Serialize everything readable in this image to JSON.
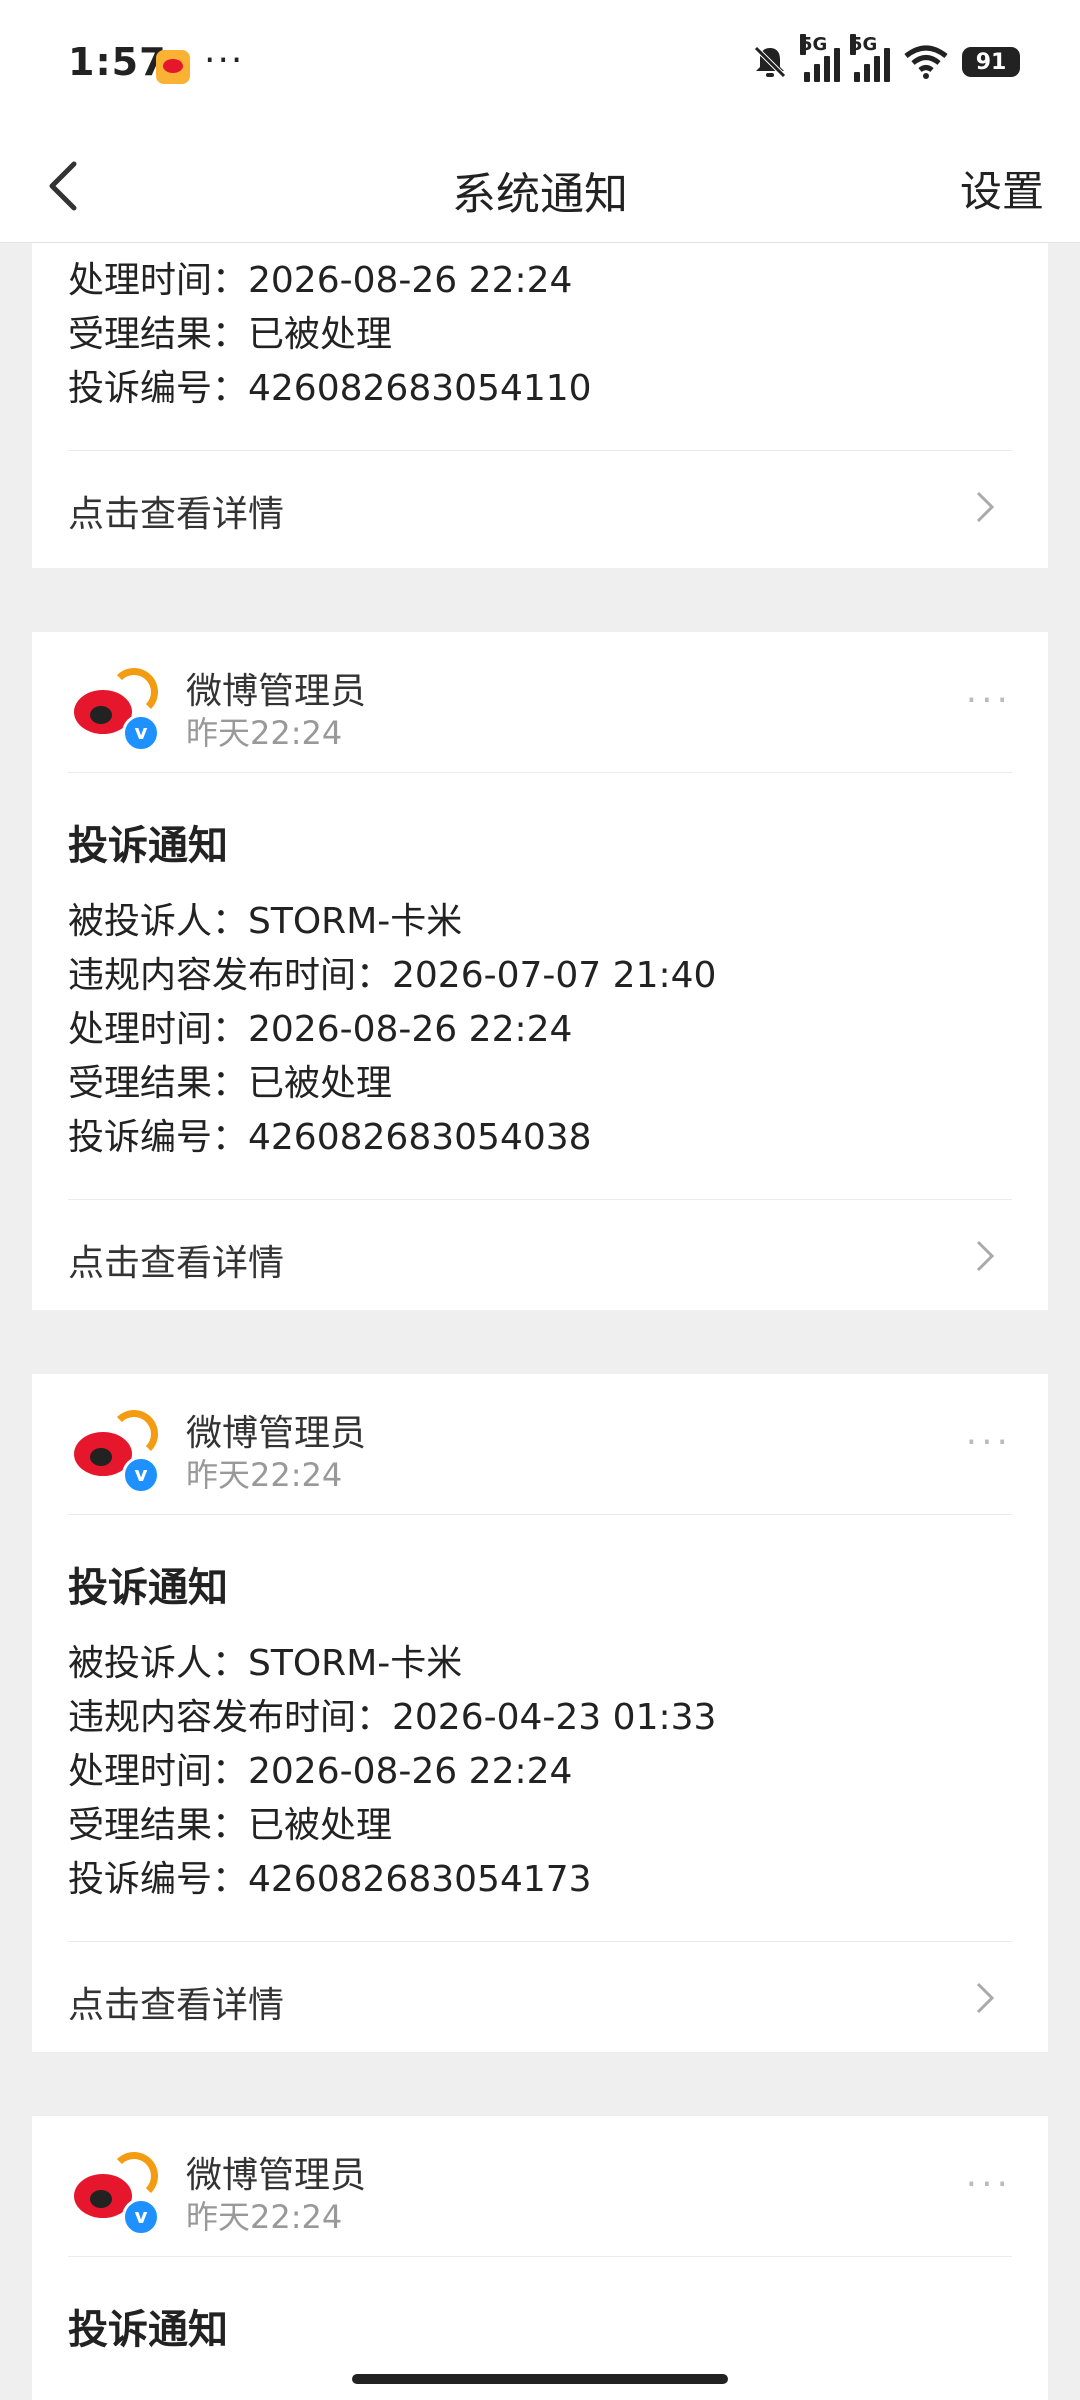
{
  "status_bar": {
    "time": "1:57",
    "more": "···",
    "network1": "5G",
    "network2": "5G",
    "battery": "91"
  },
  "nav": {
    "title": "系统通知",
    "settings_label": "设置"
  },
  "top_card": {
    "rows": [
      "处理时间：2026-08-26 22:24",
      "受理结果：已被处理",
      "投诉编号：426082683054110"
    ],
    "detail_label": "点击查看详情"
  },
  "cards": [
    {
      "sender": "微博管理员",
      "time": "昨天22:24",
      "title": "投诉通知",
      "rows": [
        "被投诉人：STORM-卡米",
        "违规内容发布时间：2026-07-07 21:40",
        "处理时间：2026-08-26 22:24",
        "受理结果：已被处理",
        "投诉编号：426082683054038"
      ],
      "detail_label": "点击查看详情"
    },
    {
      "sender": "微博管理员",
      "time": "昨天22:24",
      "title": "投诉通知",
      "rows": [
        "被投诉人：STORM-卡米",
        "违规内容发布时间：2026-04-23 01:33",
        "处理时间：2026-08-26 22:24",
        "受理结果：已被处理",
        "投诉编号：426082683054173"
      ],
      "detail_label": "点击查看详情"
    },
    {
      "sender": "微博管理员",
      "time": "昨天22:24",
      "title": "投诉通知"
    }
  ],
  "colors": {
    "background": "#efefef",
    "card": "#ffffff",
    "weibo_red": "#e6162d",
    "verified_blue": "#1e90ff"
  }
}
